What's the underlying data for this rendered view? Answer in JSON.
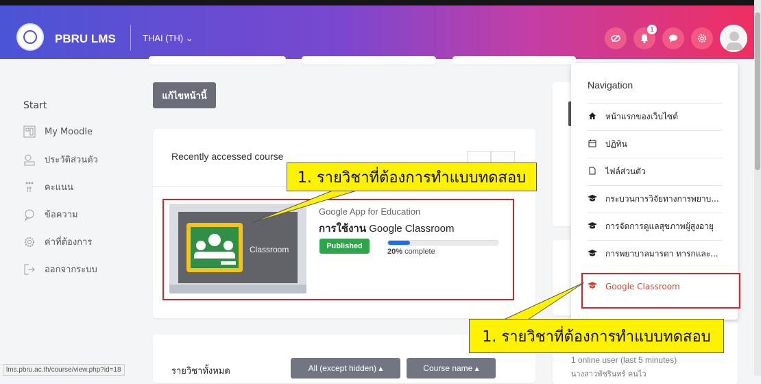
{
  "header": {
    "brand": "PBRU LMS",
    "language": "THAI (TH) ⌄",
    "notifications_badge": "1",
    "icons": [
      "eye-slash-icon",
      "bell-icon",
      "chat-icon",
      "gear-icon",
      "avatar"
    ]
  },
  "sidebar": {
    "start": "Start",
    "items": [
      {
        "label": "My Moodle",
        "icon": "dashboard-icon"
      },
      {
        "label": "ประวัติส่วนตัว",
        "icon": "profile-icon"
      },
      {
        "label": "คะแนน",
        "icon": "grades-icon"
      },
      {
        "label": "ข้อความ",
        "icon": "message-icon"
      },
      {
        "label": "ค่าที่ต้องการ",
        "icon": "settings-icon"
      },
      {
        "label": "ออกจากระบบ",
        "icon": "logout-icon"
      }
    ]
  },
  "main": {
    "edit_button": "แก้ไขหน้านี้",
    "recent_title": "Recently accessed course",
    "course": {
      "category": "Google App for Education",
      "name_bold": "การใช้งาน",
      "name_rest": " Google Classroom",
      "image_word": "Classroom",
      "status": "Published",
      "progress_percent": 20,
      "progress_pct_label": "20%",
      "progress_suffix": " complete"
    },
    "all_courses_title": "รายวิชาทั้งหมด",
    "filter_button": "All (except hidden) ▴",
    "sort_button": "Course name ▴"
  },
  "dropdown": {
    "title": "Navigation",
    "items": [
      {
        "label": "หน้าแรกของเว็บไซต์",
        "icon": "home-icon"
      },
      {
        "label": "ปฏิทิน",
        "icon": "calendar-icon"
      },
      {
        "label": "ไฟล์ส่วนตัว",
        "icon": "file-icon"
      },
      {
        "label": "กระบวนการวิจัยทางการพยาบ...",
        "icon": "graduation-cap-icon"
      },
      {
        "label": "การจัดการดูแลสุขภาพผู้สูงอายุ",
        "icon": "graduation-cap-icon"
      },
      {
        "label": "การพยาบาลมารดา ทารกและ...",
        "icon": "graduation-cap-icon"
      },
      {
        "label": "Google Classroom",
        "icon": "graduation-cap-icon",
        "active": true
      }
    ]
  },
  "callouts": {
    "upper": "1. รายวิชาที่ต้องการทำแบบทดสอบ",
    "lower": "1. รายวิชาที่ต้องการทำแบบทดสอบ"
  },
  "online": {
    "title": "1 online user (last 5 minutes)",
    "name": "นางสาวพัชรินทร์ คนไว"
  },
  "status_url": "lms.pbru.ac.th/course/view.php?id=18",
  "colors": {
    "gradient_start": "#4b54d6",
    "gradient_end": "#ef2f61",
    "published": "#2ca64b",
    "progress": "#1b6cf2",
    "highlight_box": "#e31b23",
    "callout": "#fff200",
    "active_nav": "#d9472b"
  }
}
